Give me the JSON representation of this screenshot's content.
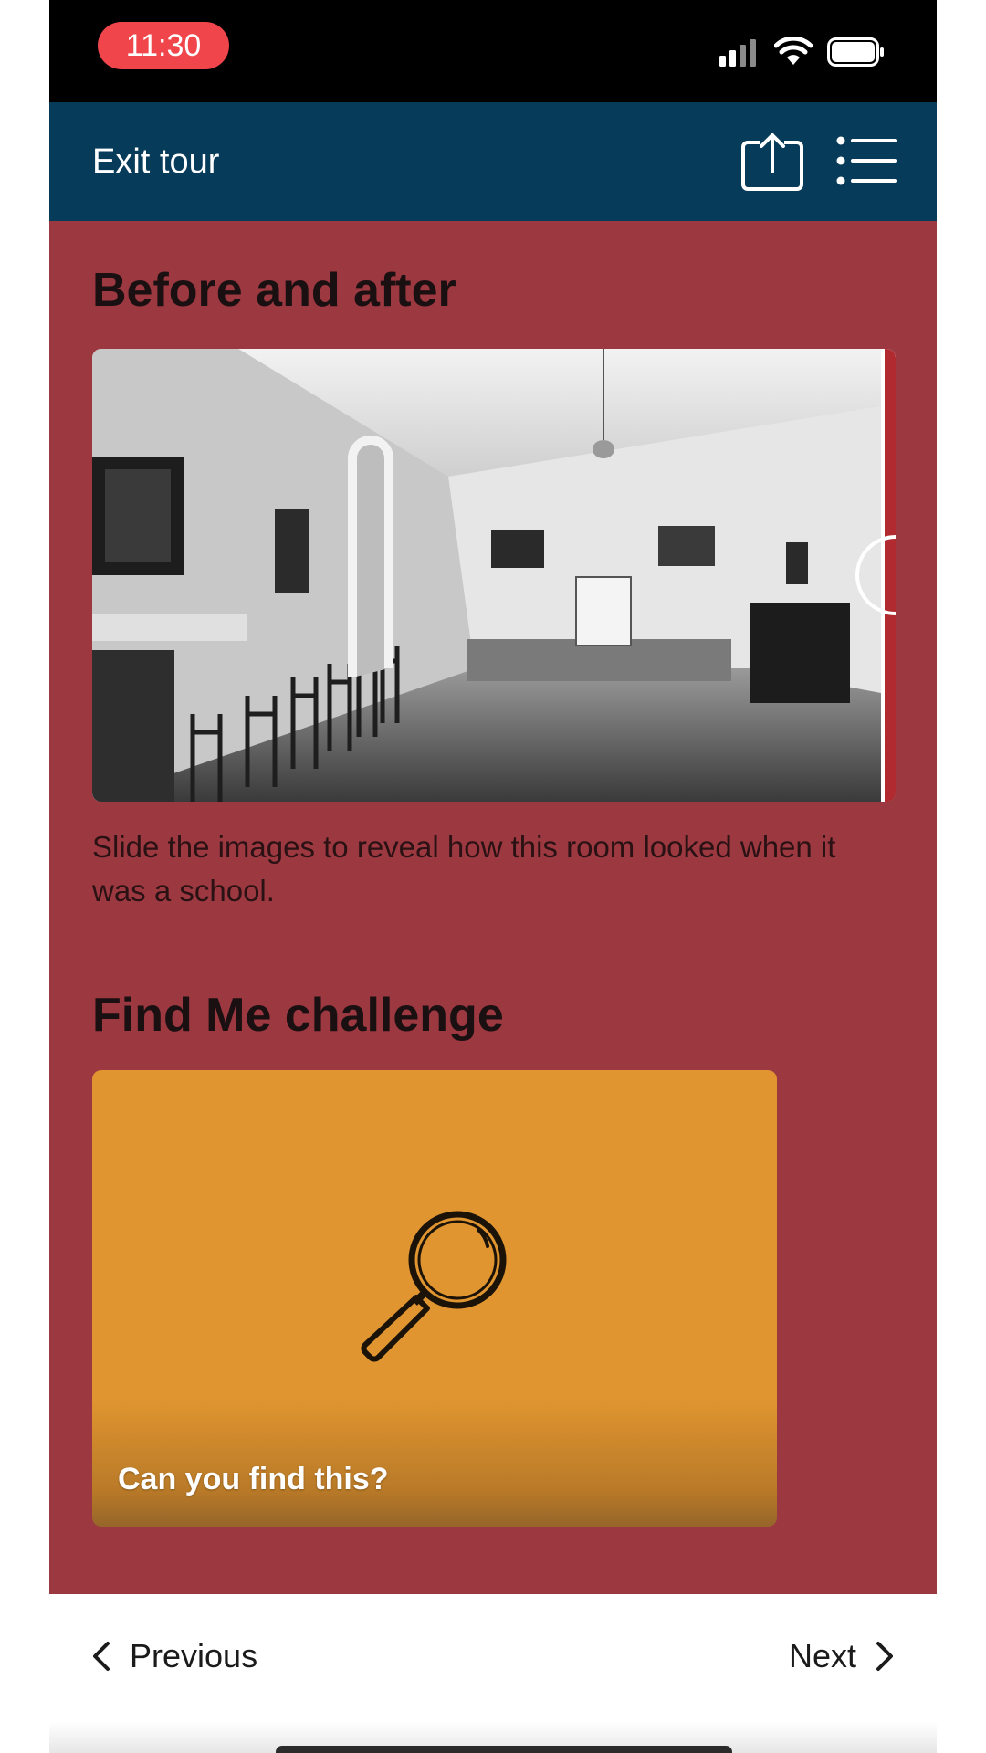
{
  "status_bar": {
    "time": "11:30"
  },
  "header": {
    "exit_label": "Exit tour"
  },
  "before_after": {
    "title": "Before and after",
    "caption": "Slide the images to reveal how this room looked when it was a school."
  },
  "find_me": {
    "title": "Find Me challenge",
    "card_label": "Can you find this?"
  },
  "bottom_nav": {
    "previous_label": "Previous",
    "next_label": "Next"
  },
  "colors": {
    "status_pill": "#f0454a",
    "header_bg": "#073b5a",
    "content_bg": "#9c3840",
    "card_bg": "#e09530"
  },
  "icons": [
    "signal-icon",
    "wifi-icon",
    "battery-icon",
    "share-icon",
    "list-menu-icon",
    "magnifier-icon",
    "chevron-left-icon",
    "chevron-right-icon"
  ]
}
